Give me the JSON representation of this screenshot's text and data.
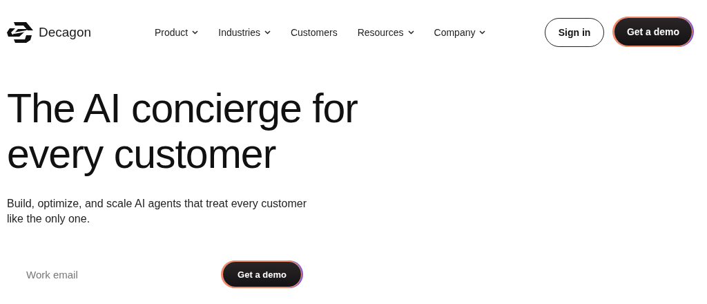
{
  "header": {
    "brand": "Decagon",
    "nav": [
      {
        "label": "Product",
        "has_menu": true
      },
      {
        "label": "Industries",
        "has_menu": true
      },
      {
        "label": "Customers",
        "has_menu": false
      },
      {
        "label": "Resources",
        "has_menu": true
      },
      {
        "label": "Company",
        "has_menu": true
      }
    ],
    "sign_in": "Sign in",
    "cta": "Get a demo"
  },
  "hero": {
    "headline": [
      "The AI concierge for",
      "every customer"
    ],
    "subtitle": "Build, optimize, and scale AI agents that treat every customer like the only one.",
    "email": {
      "placeholder": "Work email"
    },
    "cta": "Get a demo"
  }
}
